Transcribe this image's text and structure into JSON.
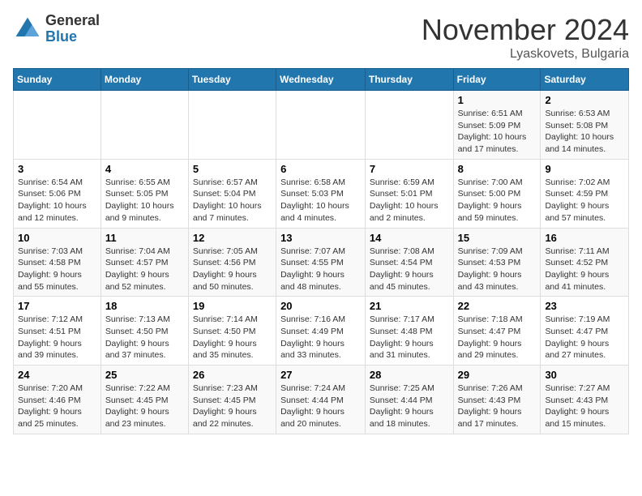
{
  "header": {
    "logo_general": "General",
    "logo_blue": "Blue",
    "month_title": "November 2024",
    "location": "Lyaskovets, Bulgaria"
  },
  "weekdays": [
    "Sunday",
    "Monday",
    "Tuesday",
    "Wednesday",
    "Thursday",
    "Friday",
    "Saturday"
  ],
  "weeks": [
    [
      {
        "day": "",
        "info": ""
      },
      {
        "day": "",
        "info": ""
      },
      {
        "day": "",
        "info": ""
      },
      {
        "day": "",
        "info": ""
      },
      {
        "day": "",
        "info": ""
      },
      {
        "day": "1",
        "info": "Sunrise: 6:51 AM\nSunset: 5:09 PM\nDaylight: 10 hours and 17 minutes."
      },
      {
        "day": "2",
        "info": "Sunrise: 6:53 AM\nSunset: 5:08 PM\nDaylight: 10 hours and 14 minutes."
      }
    ],
    [
      {
        "day": "3",
        "info": "Sunrise: 6:54 AM\nSunset: 5:06 PM\nDaylight: 10 hours and 12 minutes."
      },
      {
        "day": "4",
        "info": "Sunrise: 6:55 AM\nSunset: 5:05 PM\nDaylight: 10 hours and 9 minutes."
      },
      {
        "day": "5",
        "info": "Sunrise: 6:57 AM\nSunset: 5:04 PM\nDaylight: 10 hours and 7 minutes."
      },
      {
        "day": "6",
        "info": "Sunrise: 6:58 AM\nSunset: 5:03 PM\nDaylight: 10 hours and 4 minutes."
      },
      {
        "day": "7",
        "info": "Sunrise: 6:59 AM\nSunset: 5:01 PM\nDaylight: 10 hours and 2 minutes."
      },
      {
        "day": "8",
        "info": "Sunrise: 7:00 AM\nSunset: 5:00 PM\nDaylight: 9 hours and 59 minutes."
      },
      {
        "day": "9",
        "info": "Sunrise: 7:02 AM\nSunset: 4:59 PM\nDaylight: 9 hours and 57 minutes."
      }
    ],
    [
      {
        "day": "10",
        "info": "Sunrise: 7:03 AM\nSunset: 4:58 PM\nDaylight: 9 hours and 55 minutes."
      },
      {
        "day": "11",
        "info": "Sunrise: 7:04 AM\nSunset: 4:57 PM\nDaylight: 9 hours and 52 minutes."
      },
      {
        "day": "12",
        "info": "Sunrise: 7:05 AM\nSunset: 4:56 PM\nDaylight: 9 hours and 50 minutes."
      },
      {
        "day": "13",
        "info": "Sunrise: 7:07 AM\nSunset: 4:55 PM\nDaylight: 9 hours and 48 minutes."
      },
      {
        "day": "14",
        "info": "Sunrise: 7:08 AM\nSunset: 4:54 PM\nDaylight: 9 hours and 45 minutes."
      },
      {
        "day": "15",
        "info": "Sunrise: 7:09 AM\nSunset: 4:53 PM\nDaylight: 9 hours and 43 minutes."
      },
      {
        "day": "16",
        "info": "Sunrise: 7:11 AM\nSunset: 4:52 PM\nDaylight: 9 hours and 41 minutes."
      }
    ],
    [
      {
        "day": "17",
        "info": "Sunrise: 7:12 AM\nSunset: 4:51 PM\nDaylight: 9 hours and 39 minutes."
      },
      {
        "day": "18",
        "info": "Sunrise: 7:13 AM\nSunset: 4:50 PM\nDaylight: 9 hours and 37 minutes."
      },
      {
        "day": "19",
        "info": "Sunrise: 7:14 AM\nSunset: 4:50 PM\nDaylight: 9 hours and 35 minutes."
      },
      {
        "day": "20",
        "info": "Sunrise: 7:16 AM\nSunset: 4:49 PM\nDaylight: 9 hours and 33 minutes."
      },
      {
        "day": "21",
        "info": "Sunrise: 7:17 AM\nSunset: 4:48 PM\nDaylight: 9 hours and 31 minutes."
      },
      {
        "day": "22",
        "info": "Sunrise: 7:18 AM\nSunset: 4:47 PM\nDaylight: 9 hours and 29 minutes."
      },
      {
        "day": "23",
        "info": "Sunrise: 7:19 AM\nSunset: 4:47 PM\nDaylight: 9 hours and 27 minutes."
      }
    ],
    [
      {
        "day": "24",
        "info": "Sunrise: 7:20 AM\nSunset: 4:46 PM\nDaylight: 9 hours and 25 minutes."
      },
      {
        "day": "25",
        "info": "Sunrise: 7:22 AM\nSunset: 4:45 PM\nDaylight: 9 hours and 23 minutes."
      },
      {
        "day": "26",
        "info": "Sunrise: 7:23 AM\nSunset: 4:45 PM\nDaylight: 9 hours and 22 minutes."
      },
      {
        "day": "27",
        "info": "Sunrise: 7:24 AM\nSunset: 4:44 PM\nDaylight: 9 hours and 20 minutes."
      },
      {
        "day": "28",
        "info": "Sunrise: 7:25 AM\nSunset: 4:44 PM\nDaylight: 9 hours and 18 minutes."
      },
      {
        "day": "29",
        "info": "Sunrise: 7:26 AM\nSunset: 4:43 PM\nDaylight: 9 hours and 17 minutes."
      },
      {
        "day": "30",
        "info": "Sunrise: 7:27 AM\nSunset: 4:43 PM\nDaylight: 9 hours and 15 minutes."
      }
    ]
  ]
}
